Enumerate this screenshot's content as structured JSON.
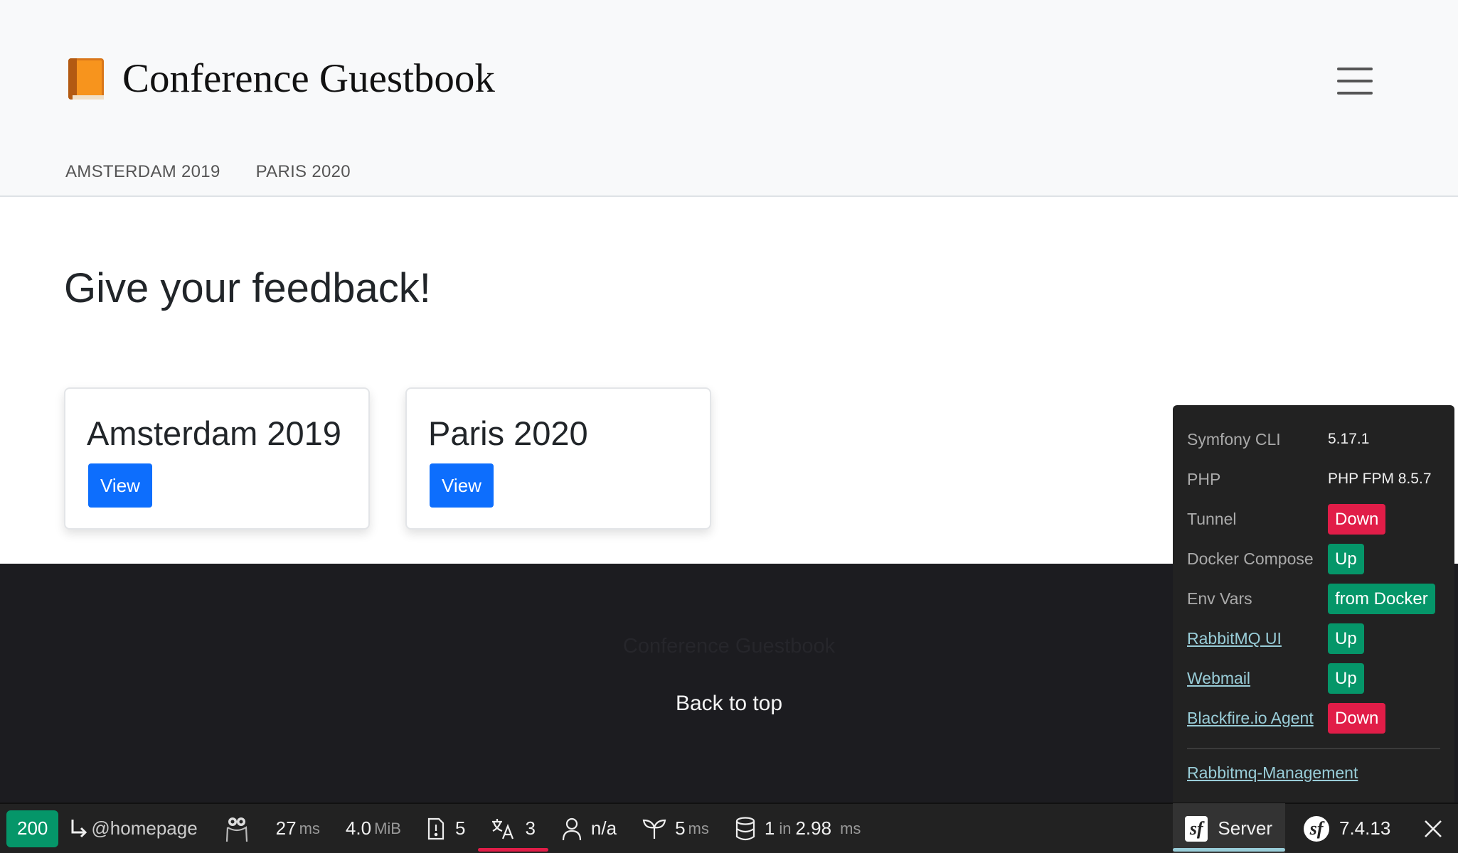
{
  "header": {
    "title": "Conference Guestbook",
    "nav": [
      "AMSTERDAM 2019",
      "PARIS 2020"
    ]
  },
  "main": {
    "heading": "Give your feedback!",
    "cards": [
      {
        "title": "Amsterdam 2019",
        "button": "View"
      },
      {
        "title": "Paris 2020",
        "button": "View"
      }
    ]
  },
  "footer": {
    "brand": "Conference Guestbook",
    "back_to_top": "Back to top"
  },
  "toolbar": {
    "status": "200",
    "route": "@homepage",
    "time_value": "27",
    "time_unit": "ms",
    "memory_value": "4.0",
    "memory_unit": "MiB",
    "logs_count": "5",
    "translations_count": "3",
    "user": "n/a",
    "twig_value": "5",
    "twig_unit": "ms",
    "db_queries": "1",
    "db_in": "in",
    "db_time": "2.98",
    "db_unit": "ms",
    "server_label": "Server",
    "symfony_version": "7.4.13",
    "colors": {
      "success": "#059669",
      "error": "#e11d48"
    }
  },
  "server_panel": {
    "rows": [
      {
        "key": "Symfony CLI",
        "value": "5.17.1"
      },
      {
        "key": "PHP",
        "value": "PHP FPM 8.5.7"
      },
      {
        "key": "Tunnel",
        "badge": "Down"
      },
      {
        "key": "Docker Compose",
        "badge": "Up"
      },
      {
        "key": "Env Vars",
        "badge": "from Docker"
      },
      {
        "key": "RabbitMQ UI",
        "badge": "Up"
      },
      {
        "key": "Webmail",
        "badge": "Up"
      },
      {
        "key": "Blackfire.io Agent",
        "badge": "Down"
      }
    ],
    "footer_link": "Rabbitmq-Management"
  }
}
